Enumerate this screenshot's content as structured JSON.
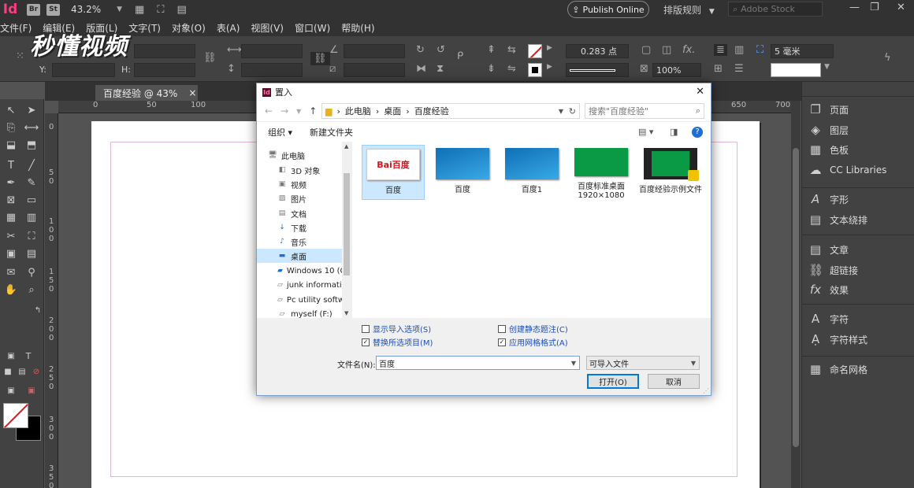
{
  "app": {
    "icon": "Id",
    "bridge_badge": "Br",
    "stock_badge": "St",
    "zoom": "43.2%",
    "publish_label": "Publish Online",
    "layout_rule": "排版规则",
    "stock_search": "Adobe Stock"
  },
  "menu": [
    "文件(F)",
    "编辑(E)",
    "版面(L)",
    "文字(T)",
    "对象(O)",
    "表(A)",
    "视图(V)",
    "窗口(W)",
    "帮助(H)"
  ],
  "watermark": "秒懂视频",
  "control": {
    "y_label": "Y:",
    "h_label": "H:",
    "stroke_weight": "0.283 点",
    "opacity": "100%",
    "gutter": "5 毫米"
  },
  "document": {
    "tab_title": "百度经验 @ 43%",
    "close": "×",
    "ruler_h": [
      "0",
      "50",
      "100",
      "650",
      "700"
    ],
    "ruler_v": [
      "0",
      "5 0",
      "1 0 0",
      "1 5 0",
      "2 0 0",
      "2 5 0",
      "3 0 0",
      "3 5 0"
    ]
  },
  "panels": {
    "group1": [
      "页面",
      "图层",
      "色板",
      "CC Libraries"
    ],
    "group2": [
      "字形",
      "文本绕排"
    ],
    "group3": [
      "文章",
      "超链接",
      "效果"
    ],
    "group4": [
      "字符",
      "字符样式"
    ],
    "group5": [
      "命名网格"
    ]
  },
  "dialog": {
    "title": "置入",
    "breadcrumb": [
      "此电脑",
      "桌面",
      "百度经验"
    ],
    "search_placeholder": "搜索\"百度经验\"",
    "organize": "组织 ▾",
    "new_folder": "新建文件夹",
    "tree": [
      "此电脑",
      "3D 对象",
      "视频",
      "图片",
      "文档",
      "下载",
      "音乐",
      "桌面",
      "Windows 10 (C",
      "junk informatio",
      "Pc  utility softw",
      "myself (F:)"
    ],
    "tree_selected": 7,
    "files": [
      {
        "name": "百度",
        "thumb": "baidu"
      },
      {
        "name": "百度",
        "thumb": "blue"
      },
      {
        "name": "百度1",
        "thumb": "blue"
      },
      {
        "name": "百度标准桌面 1920×1080",
        "thumb": "green"
      },
      {
        "name": "百度经验示例文件",
        "thumb": "film"
      }
    ],
    "baidu_logo": "Bai百度",
    "options": {
      "show_import": "显示导入选项(S)",
      "show_import_checked": false,
      "replace_selected": "替换所选项目(M)",
      "replace_selected_checked": true,
      "create_caption": "创建静态题注(C)",
      "create_caption_checked": false,
      "apply_grid": "应用网格格式(A)",
      "apply_grid_checked": true
    },
    "filename_label": "文件名(N):",
    "filename_value": "百度",
    "filetype": "可导入文件",
    "open": "打开(O)",
    "cancel": "取消"
  }
}
